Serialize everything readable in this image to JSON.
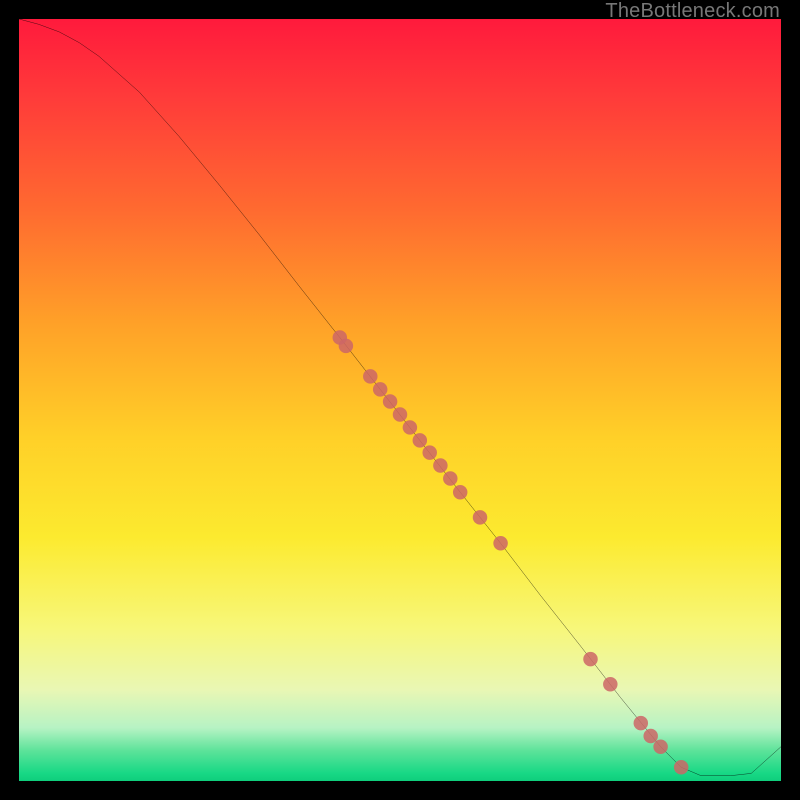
{
  "watermark": "TheBottleneck.com",
  "chart_data": {
    "type": "line",
    "title": "",
    "xlabel": "",
    "ylabel": "",
    "xlim": [
      0,
      100
    ],
    "ylim": [
      0,
      100
    ],
    "grid": false,
    "legend": false,
    "note": "Axes unlabeled in source image; x and y are normalized 0–100 from pixel positions.",
    "series": [
      {
        "name": "curve",
        "color": "#000000",
        "x": [
          0.0,
          2.6,
          5.3,
          7.9,
          10.5,
          15.8,
          21.0,
          26.3,
          31.6,
          36.8,
          42.1,
          47.4,
          52.6,
          57.9,
          63.2,
          68.4,
          73.7,
          78.9,
          84.2,
          86.9,
          89.5,
          93.4,
          96.1,
          100.0
        ],
        "y": [
          100.0,
          99.3,
          98.3,
          96.9,
          95.1,
          90.4,
          84.6,
          78.2,
          71.6,
          64.9,
          58.2,
          51.4,
          44.7,
          37.9,
          31.2,
          24.4,
          17.7,
          11.0,
          4.5,
          1.8,
          0.7,
          0.7,
          1.0,
          4.5
        ]
      },
      {
        "name": "markers",
        "color": "#cc6666",
        "marker": "circle",
        "x": [
          42.1,
          42.9,
          46.1,
          47.4,
          48.7,
          50.0,
          51.3,
          52.6,
          53.9,
          55.3,
          56.6,
          57.9,
          60.5,
          63.2,
          75.0,
          77.6,
          81.6,
          82.9,
          84.2,
          86.9
        ],
        "y": [
          58.2,
          57.1,
          53.1,
          51.4,
          49.8,
          48.1,
          46.4,
          44.7,
          43.1,
          41.4,
          39.7,
          37.9,
          34.6,
          31.2,
          16.0,
          12.7,
          7.6,
          5.9,
          4.5,
          1.8
        ]
      }
    ],
    "background_gradient": {
      "direction": "top_to_bottom",
      "stops": [
        {
          "pos": 0.0,
          "color": "#ff1a3c"
        },
        {
          "pos": 0.25,
          "color": "#ff6a30"
        },
        {
          "pos": 0.55,
          "color": "#ffd028"
        },
        {
          "pos": 0.8,
          "color": "#f7f77a"
        },
        {
          "pos": 0.95,
          "color": "#5de39a"
        },
        {
          "pos": 1.0,
          "color": "#0fce7c"
        }
      ]
    }
  }
}
